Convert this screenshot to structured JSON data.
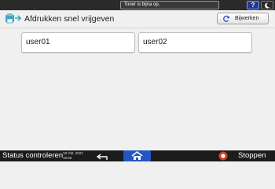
{
  "topbar": {
    "notice": "Toner is bijna op.",
    "help_label": "?",
    "sleep_icon": "moon-icon"
  },
  "header": {
    "title": "Afdrukken snel vrijgeven",
    "app_icon": "quick-release-print-icon",
    "refresh_label": "Bijwerken",
    "refresh_icon": "refresh-icon"
  },
  "users": [
    {
      "label": "user01"
    },
    {
      "label": "user02"
    }
  ],
  "bottombar": {
    "status_label": "Status controleren",
    "date": "18 Okt. 2022",
    "time": "15:58",
    "back_icon": "back-arrow-icon",
    "home_icon": "home-icon",
    "stop_label": "Stoppen",
    "stop_icon": "stop-icon"
  },
  "colors": {
    "accent": "#2355c4",
    "help_button": "#1f3a8f",
    "stop": "#d93a1f",
    "icon_teal": "#3fa7c9"
  }
}
